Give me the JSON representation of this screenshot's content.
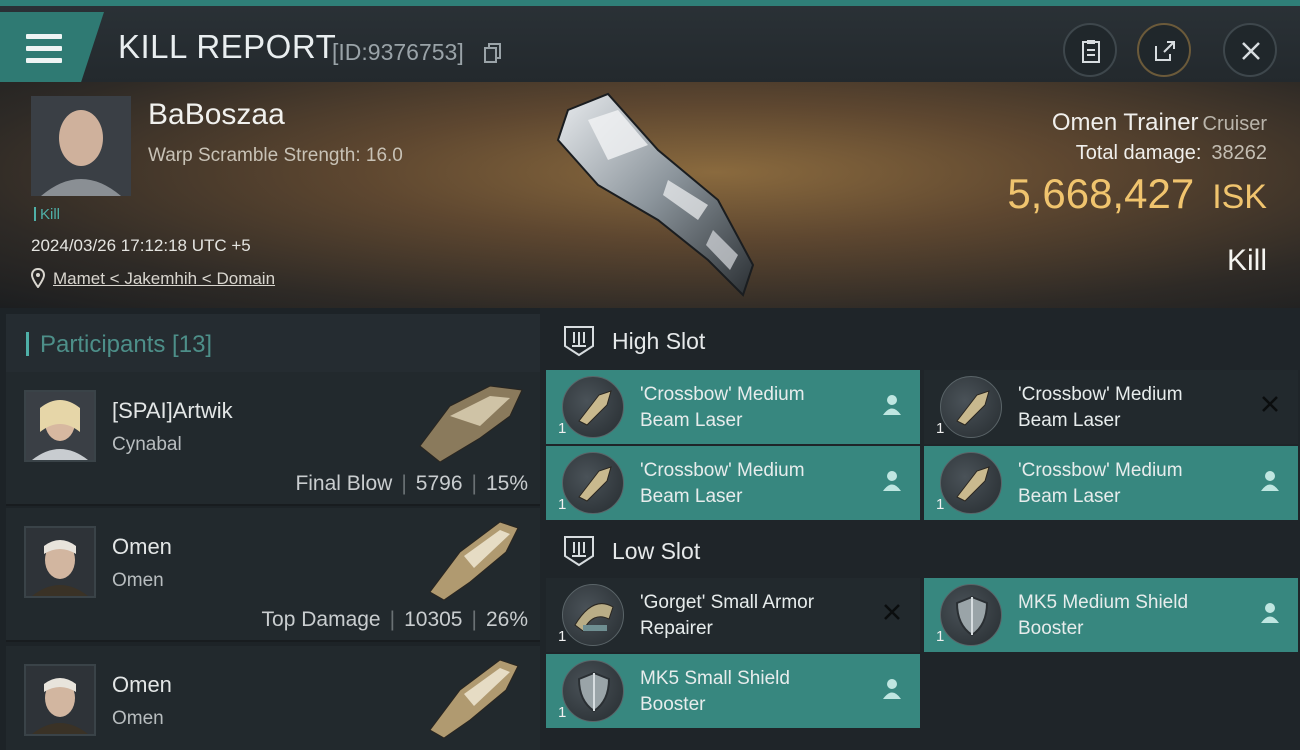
{
  "header": {
    "title": "KILL REPORT",
    "report_id": "[ID:9376753]"
  },
  "victim": {
    "name": "BaBoszaa",
    "warp_scramble": "Warp Scramble Strength: 16.0",
    "tag": "Kill",
    "datetime": "2024/03/26 17:12:18 UTC +5",
    "location": "Mamet < Jakemhih < Domain",
    "ship_name": "Omen Trainer",
    "ship_class": "Cruiser",
    "total_damage_label": "Total damage:",
    "total_damage_value": "38262",
    "isk_value": "5,668,427",
    "isk_unit": "ISK",
    "result": "Kill"
  },
  "participants": {
    "title": "Participants [13]",
    "rows": [
      {
        "name": "[SPAI]Artwik",
        "ship": "Cynabal",
        "role": "Final Blow",
        "damage": "5796",
        "percent": "15%"
      },
      {
        "name": "Omen",
        "ship": "Omen",
        "role": "Top Damage",
        "damage": "10305",
        "percent": "26%"
      },
      {
        "name": "Omen",
        "ship": "Omen",
        "role": "",
        "damage": "",
        "percent": ""
      }
    ]
  },
  "fitting": {
    "high_slot_label": "High Slot",
    "low_slot_label": "Low Slot",
    "high_slot": [
      {
        "line1": "'Crossbow' Medium",
        "line2": "Beam Laser",
        "qty": "1",
        "state": "dropped"
      },
      {
        "line1": "'Crossbow' Medium",
        "line2": "Beam Laser",
        "qty": "1",
        "state": "destroyed"
      },
      {
        "line1": "'Crossbow' Medium",
        "line2": "Beam Laser",
        "qty": "1",
        "state": "dropped"
      },
      {
        "line1": "'Crossbow' Medium",
        "line2": "Beam Laser",
        "qty": "1",
        "state": "dropped"
      }
    ],
    "low_slot": [
      {
        "line1": "'Gorget' Small Armor",
        "line2": "Repairer",
        "qty": "1",
        "state": "destroyed"
      },
      {
        "line1": "MK5 Medium Shield",
        "line2": "Booster",
        "qty": "1",
        "state": "dropped"
      },
      {
        "line1": "MK5 Small Shield",
        "line2": "Booster",
        "qty": "1",
        "state": "dropped"
      }
    ]
  },
  "colors": {
    "accent_teal": "#37877f",
    "isk_gold": "#f0c46e"
  }
}
